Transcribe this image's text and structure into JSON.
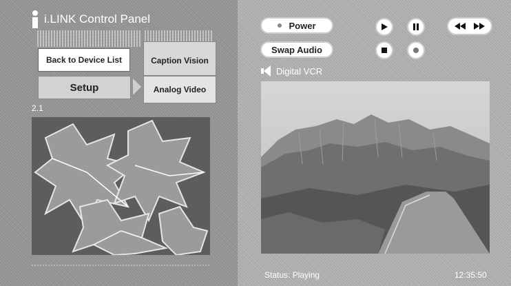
{
  "app": {
    "title": "i.LINK Control Panel"
  },
  "left": {
    "back_label": "Back to Device List",
    "caption_label": "Caption Vision",
    "setup_label": "Setup",
    "analog_label": "Analog Video",
    "channel": "2.1"
  },
  "controls": {
    "power_label": "Power",
    "swap_label": "Swap Audio"
  },
  "device": {
    "name": "Digital VCR"
  },
  "status": {
    "text": "Status: Playing",
    "time": "12:35:50"
  }
}
